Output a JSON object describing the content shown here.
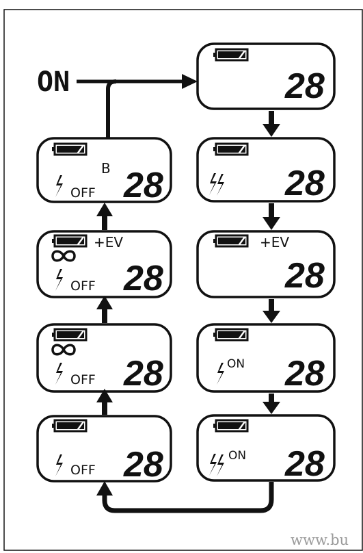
{
  "start_label": "ON",
  "displays": {
    "d1": {
      "frame_count": "28"
    },
    "d2": {
      "frame_count": "28"
    },
    "d3": {
      "frame_count": "28",
      "ev": "+EV"
    },
    "d4": {
      "frame_count": "28",
      "flash_mode": "ON"
    },
    "d5": {
      "frame_count": "28",
      "flash_mode": "ON"
    },
    "d6": {
      "frame_count": "28",
      "flash_mode": "OFF"
    },
    "d7": {
      "frame_count": "28",
      "flash_mode": "OFF"
    },
    "d8": {
      "frame_count": "28",
      "flash_mode": "OFF",
      "ev": "+EV"
    },
    "d9": {
      "frame_count": "28",
      "flash_mode": "OFF",
      "bulb": "B"
    }
  },
  "watermark": "www.bu",
  "colors": {
    "ink": "#111111",
    "background": "#ffffff",
    "watermark": "#9a9a9a"
  },
  "icons": [
    "battery-icon",
    "flash-icon",
    "auto-flash-icon",
    "infinity-icon"
  ]
}
